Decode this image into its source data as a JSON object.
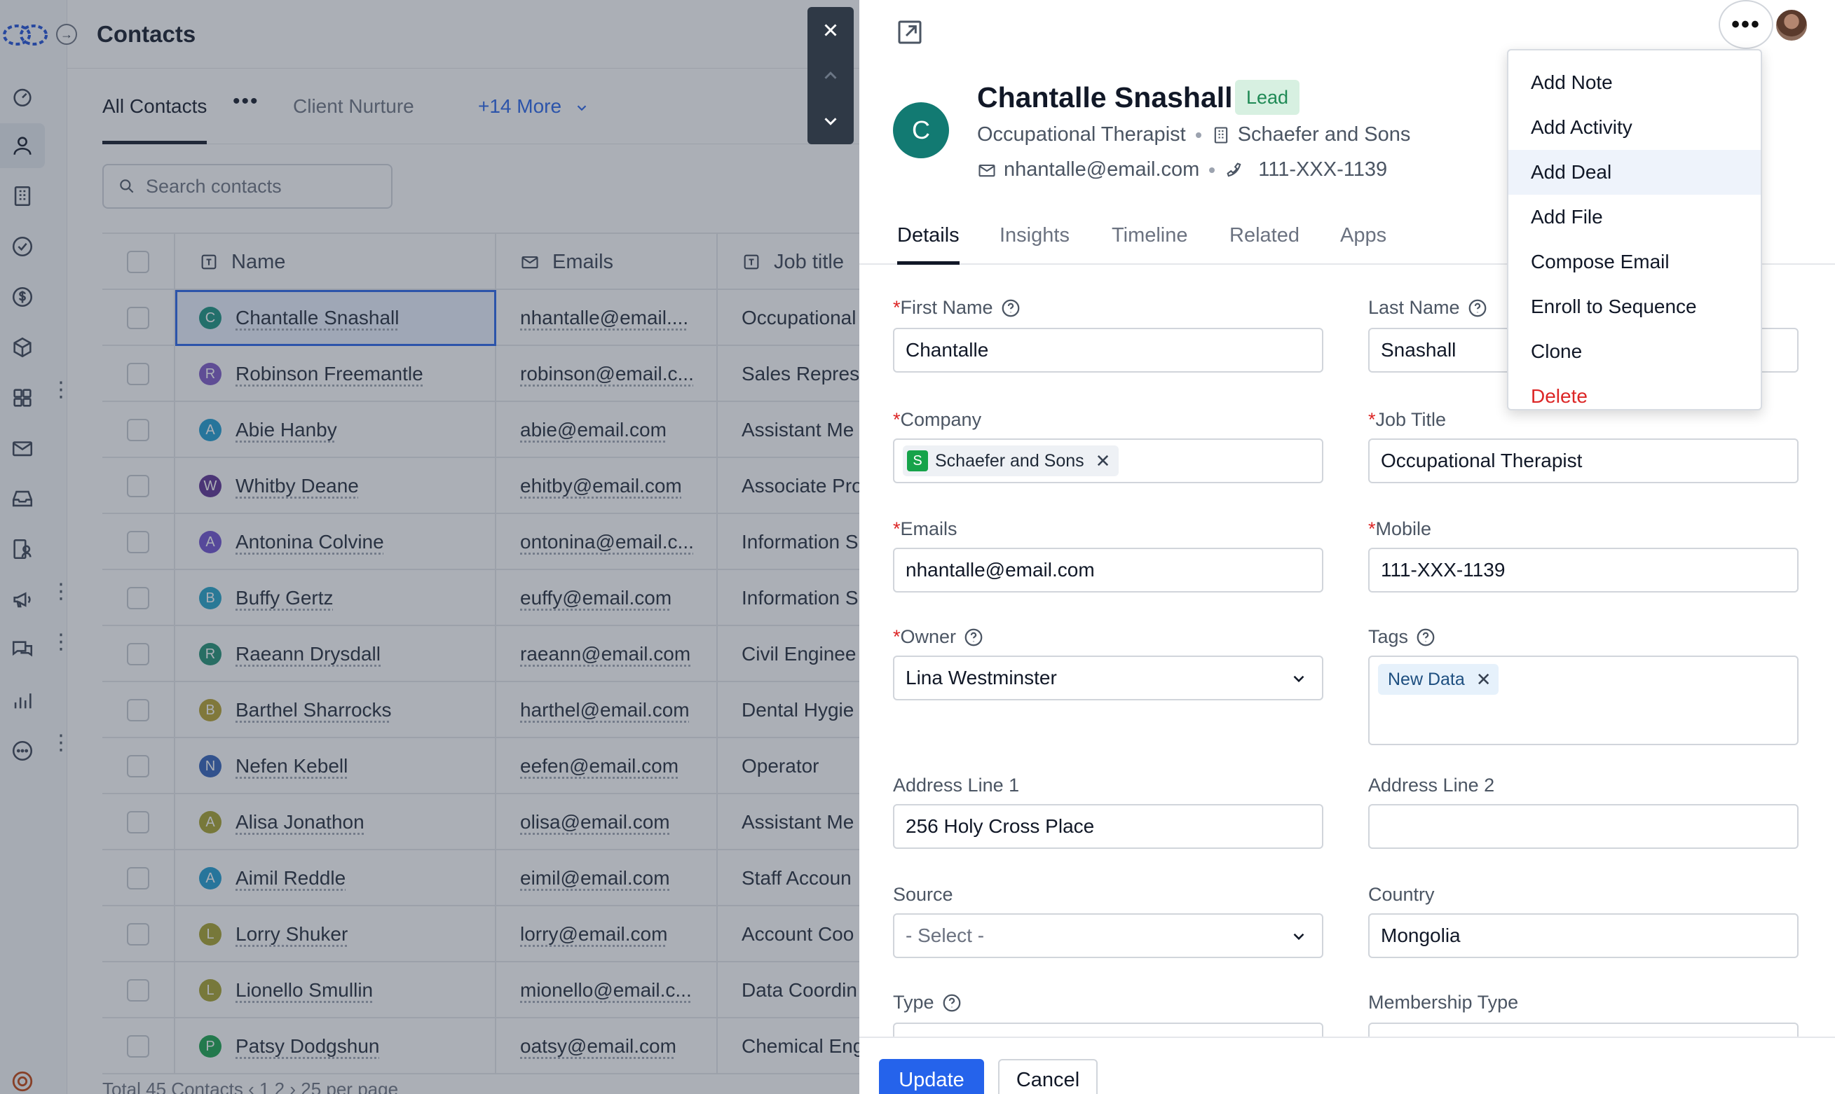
{
  "app": {
    "page_title": "Contacts"
  },
  "list": {
    "tabs": [
      {
        "label": "All Contacts",
        "active": true
      },
      {
        "label": "Client Nurture",
        "active": false
      },
      {
        "label": "+14 More",
        "active": false
      }
    ],
    "more_dots": "•••",
    "search_placeholder": "Search contacts",
    "columns": [
      "Name",
      "Emails",
      "Job title"
    ],
    "rows": [
      {
        "initial": "C",
        "color": "#16917f",
        "name": "Chantalle Snashall",
        "email": "nhantalle@email....",
        "job": "Occupational"
      },
      {
        "initial": "R",
        "color": "#7c57c7",
        "name": "Robinson Freemantle",
        "email": "robinson@email.c...",
        "job": "Sales Repres"
      },
      {
        "initial": "A",
        "color": "#1d9bd1",
        "name": "Abie Hanby",
        "email": "abie@email.com",
        "job": "Assistant Me"
      },
      {
        "initial": "W",
        "color": "#5b2d91",
        "name": "Whitby Deane",
        "email": "ehitby@email.com",
        "job": "Associate Pro"
      },
      {
        "initial": "A",
        "color": "#6d4fcf",
        "name": "Antonina Colvine",
        "email": "ontonina@email.c...",
        "job": "Information S"
      },
      {
        "initial": "B",
        "color": "#1fa2c9",
        "name": "Buffy Gertz",
        "email": "euffy@email.com",
        "job": "Information S"
      },
      {
        "initial": "R",
        "color": "#1e8f72",
        "name": "Raeann Drysdall",
        "email": "raeann@email.com",
        "job": "Civil Enginee"
      },
      {
        "initial": "B",
        "color": "#b5a02c",
        "name": "Barthel Sharrocks",
        "email": "harthel@email.com",
        "job": "Dental Hygie"
      },
      {
        "initial": "N",
        "color": "#2f5fb8",
        "name": "Nefen Kebell",
        "email": "eefen@email.com",
        "job": "Operator"
      },
      {
        "initial": "A",
        "color": "#a6a12a",
        "name": "Alisa Jonathon",
        "email": "olisa@email.com",
        "job": "Assistant Me"
      },
      {
        "initial": "A",
        "color": "#1d9bd1",
        "name": "Aimil Reddle",
        "email": "eimil@email.com",
        "job": "Staff Accoun"
      },
      {
        "initial": "L",
        "color": "#a6a12a",
        "name": "Lorry Shuker",
        "email": "lorry@email.com",
        "job": "Account Coo"
      },
      {
        "initial": "L",
        "color": "#a6a12a",
        "name": "Lionello Smullin",
        "email": "mionello@email.c...",
        "job": "Data Coordin"
      },
      {
        "initial": "P",
        "color": "#16a34a",
        "name": "Patsy Dodgshun",
        "email": "oatsy@email.com",
        "job": "Chemical Eng"
      }
    ],
    "footer_text": "Total 45 Contacts   ‹  1  2  ›   25 per page"
  },
  "detail": {
    "avatar_initial": "C",
    "name": "Chantalle Snashall",
    "badge": "Lead",
    "job_title": "Occupational Therapist",
    "company": "Schaefer and Sons",
    "email": "nhantalle@email.com",
    "phone": "111-XXX-1139",
    "tabs": [
      "Details",
      "Insights",
      "Timeline",
      "Related",
      "Apps"
    ],
    "fields": {
      "first_name": {
        "label": "First Name",
        "value": "Chantalle"
      },
      "last_name": {
        "label": "Last Name",
        "value": "Snashall"
      },
      "company": {
        "label": "Company",
        "chip_initial": "S",
        "value": "Schaefer and Sons"
      },
      "job_title": {
        "label": "Job Title",
        "value": "Occupational Therapist"
      },
      "emails": {
        "label": "Emails",
        "value": "nhantalle@email.com"
      },
      "mobile": {
        "label": "Mobile",
        "value": "111-XXX-1139"
      },
      "owner": {
        "label": "Owner",
        "value": "Lina Westminster"
      },
      "tags": {
        "label": "Tags",
        "value": "New Data"
      },
      "address1": {
        "label": "Address Line 1",
        "value": "256 Holy Cross Place"
      },
      "address2": {
        "label": "Address Line 2",
        "value": ""
      },
      "source": {
        "label": "Source",
        "placeholder": "- Select -"
      },
      "country": {
        "label": "Country",
        "value": "Mongolia"
      },
      "type": {
        "label": "Type"
      },
      "membership": {
        "label": "Membership Type"
      }
    },
    "update_label": "Update",
    "cancel_label": "Cancel"
  },
  "menu": {
    "items": [
      {
        "label": "Add Note"
      },
      {
        "label": "Add Activity"
      },
      {
        "label": "Add Deal",
        "hover": true
      },
      {
        "label": "Add File"
      },
      {
        "label": "Compose Email"
      },
      {
        "label": "Enroll to Sequence"
      },
      {
        "label": "Clone"
      },
      {
        "label": "Delete",
        "danger": true
      }
    ]
  },
  "colors": {
    "accent": "#2563eb",
    "lead_badge_bg": "#d7f0e1",
    "lead_badge_text": "#1f8a55",
    "danger": "#dc2626",
    "avatar": "#127a72"
  }
}
